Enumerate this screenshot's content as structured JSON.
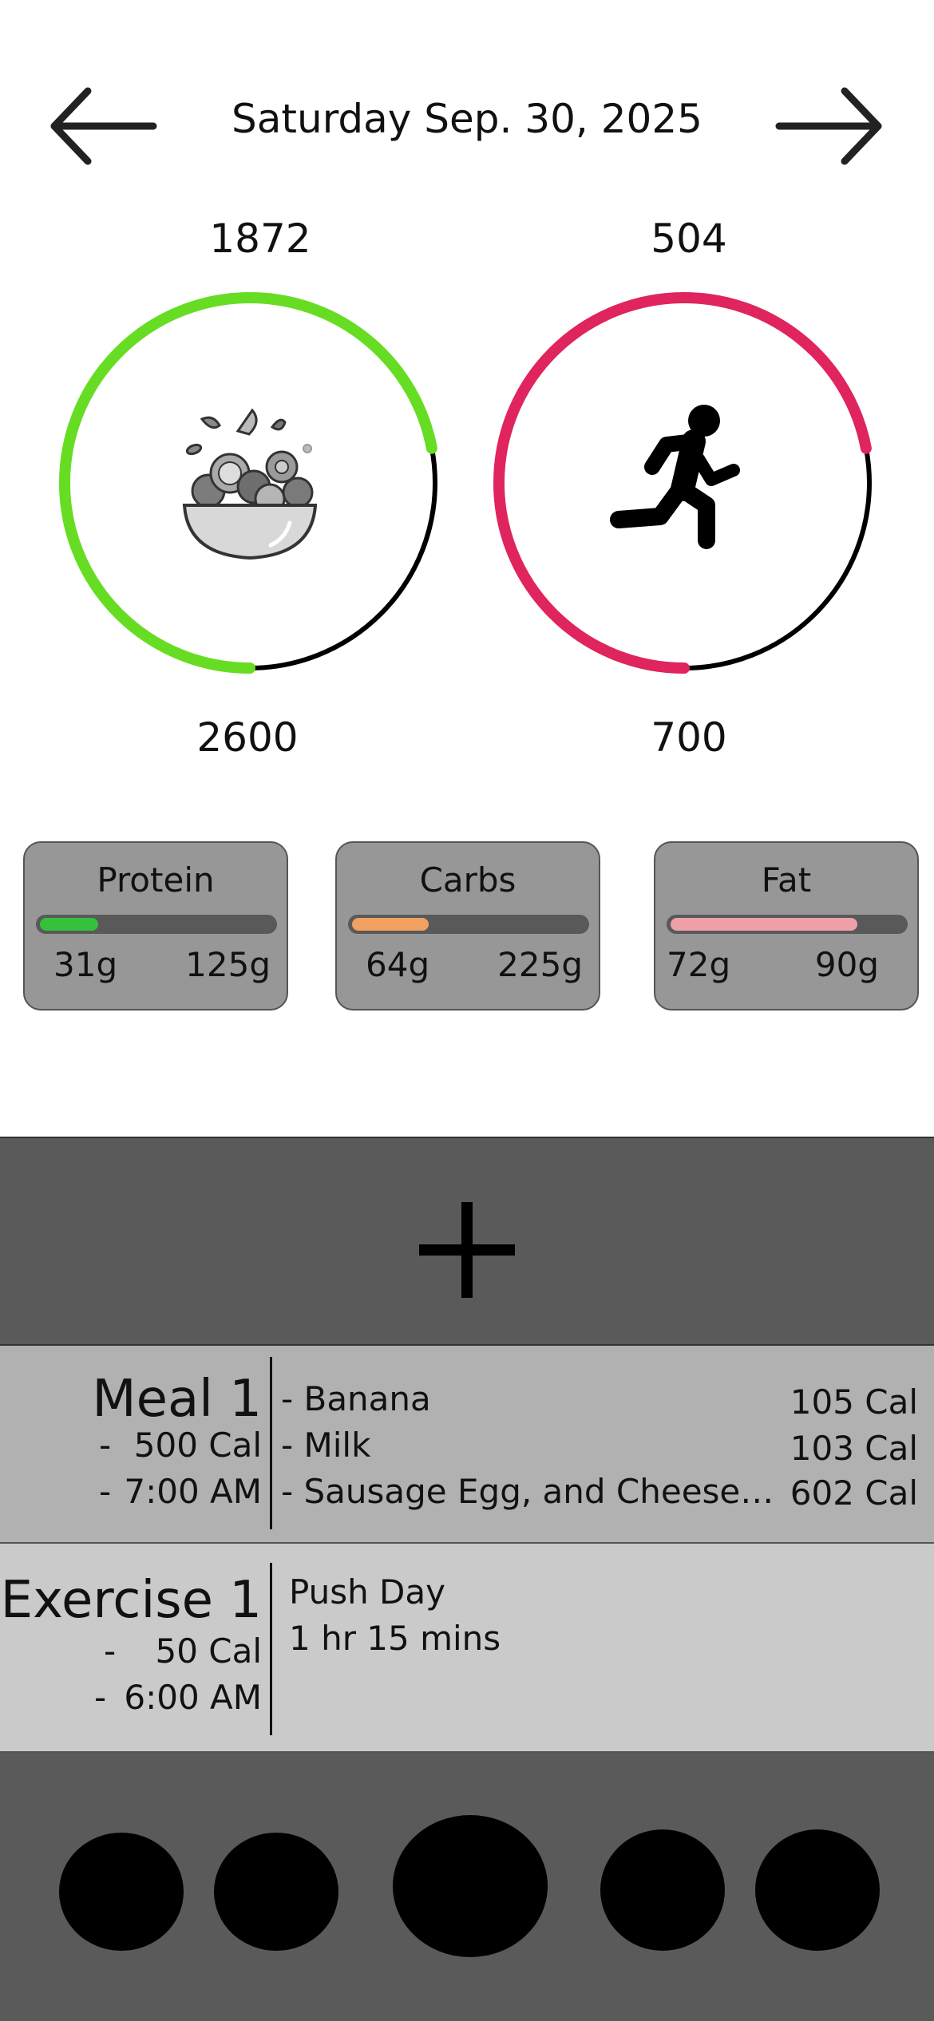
{
  "header": {
    "date": "Saturday Sep. 30, 2025",
    "prev_icon": "arrow-left-icon",
    "next_icon": "arrow-right-icon"
  },
  "intake_ring": {
    "current": "1872",
    "goal": "2600",
    "progress": 0.72,
    "color": "#66dd22",
    "icon": "salad-bowl-icon"
  },
  "exercise_ring": {
    "current": "504",
    "goal": "700",
    "progress": 0.72,
    "color": "#e0245e",
    "icon": "running-person-icon"
  },
  "macros": [
    {
      "name": "Protein",
      "current": "31g",
      "goal": "125g",
      "progress": 0.25,
      "color": "#35c13c"
    },
    {
      "name": "Carbs",
      "current": "64g",
      "goal": "225g",
      "progress": 0.33,
      "color": "#f0a060"
    },
    {
      "name": "Fat",
      "current": "72g",
      "goal": "90g",
      "progress": 0.8,
      "color": "#f0a0a8"
    }
  ],
  "add_button": {
    "icon": "plus-icon"
  },
  "meal": {
    "title": "Meal 1",
    "calories": "500 Cal",
    "time": "7:00 AM",
    "dash": "-",
    "items": [
      {
        "name": "- Banana",
        "calories": "105 Cal"
      },
      {
        "name": "- Milk",
        "calories": "103 Cal"
      },
      {
        "name": "- Sausage Egg, and Cheese Wr...",
        "calories": "602 Cal"
      }
    ]
  },
  "exercise": {
    "title": "Exercise 1",
    "calories": "50 Cal",
    "time": "6:00 AM",
    "dash": "-",
    "name": "Push Day",
    "duration": "1 hr 15 mins"
  },
  "bottom_nav": {
    "items": [
      "nav-item-1",
      "nav-item-2",
      "nav-item-center",
      "nav-item-4",
      "nav-item-5"
    ]
  }
}
